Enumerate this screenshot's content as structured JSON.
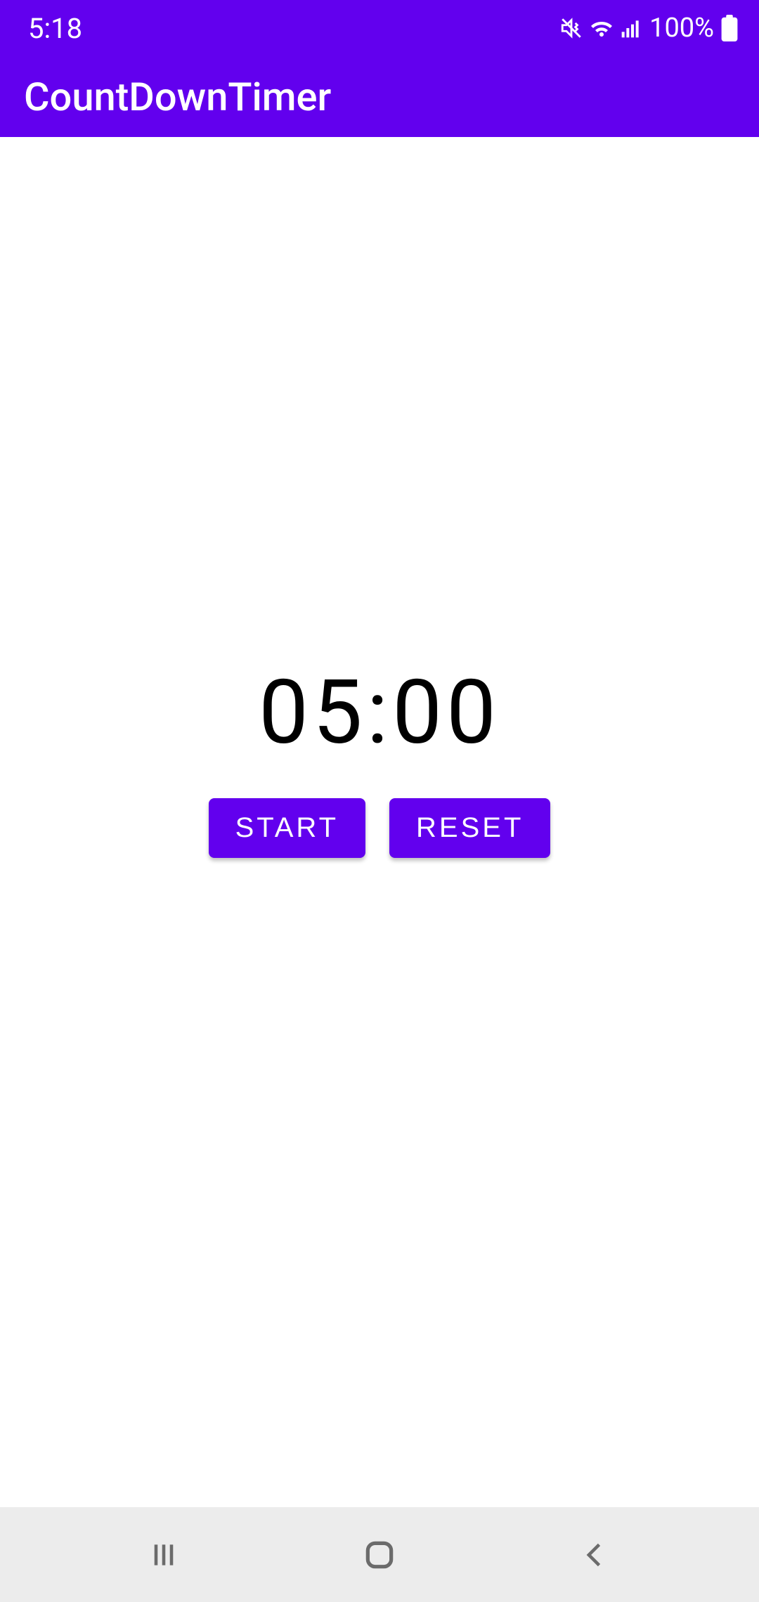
{
  "status_bar": {
    "time": "5:18",
    "battery_percent": "100%"
  },
  "app_bar": {
    "title": "CountDownTimer"
  },
  "timer": {
    "display": "05:00"
  },
  "buttons": {
    "start": "START",
    "reset": "RESET"
  },
  "colors": {
    "primary": "#6200ee",
    "background": "#ffffff",
    "nav_bar": "#ececec"
  }
}
